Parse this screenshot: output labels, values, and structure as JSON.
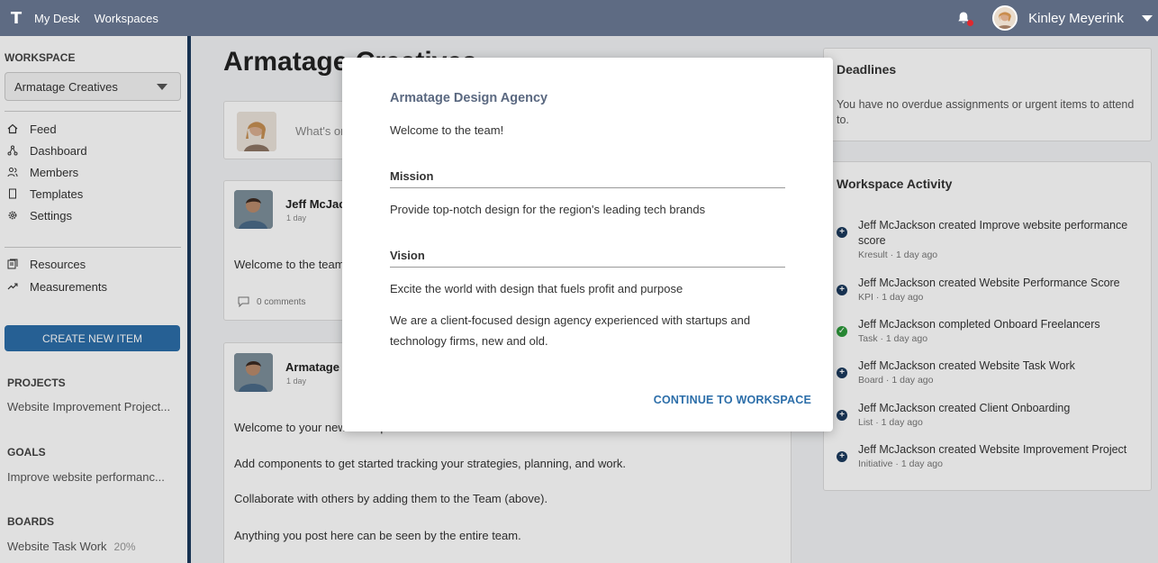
{
  "topbar": {
    "logo": "T",
    "nav": [
      "My Desk",
      "Workspaces"
    ],
    "user_name": "Kinley Meyerink"
  },
  "sidebar": {
    "workspace_heading": "WORKSPACE",
    "workspace_selected": "Armatage Creatives",
    "nav_items": [
      {
        "label": "Feed",
        "icon": "home-icon"
      },
      {
        "label": "Dashboard",
        "icon": "dashboard-icon"
      },
      {
        "label": "Members",
        "icon": "members-icon"
      },
      {
        "label": "Templates",
        "icon": "templates-icon"
      },
      {
        "label": "Settings",
        "icon": "gear-icon"
      }
    ],
    "secondary_items": [
      {
        "label": "Resources",
        "icon": "resources-icon"
      },
      {
        "label": "Measurements",
        "icon": "trend-icon"
      }
    ],
    "create_button": "CREATE NEW ITEM",
    "projects_heading": "PROJECTS",
    "project": "Website Improvement Project...",
    "goals_heading": "GOALS",
    "goal": "Improve website performanc...",
    "boards_heading": "BOARDS",
    "board": "Website Task Work",
    "board_pct": "20%"
  },
  "main": {
    "title": "Armatage Creatives",
    "compose_placeholder": "What's on your mind?",
    "posts": [
      {
        "author": "Jeff McJackson",
        "time": "1 day",
        "text": "Welcome to the team!",
        "comments": "0 comments"
      },
      {
        "author": "Armatage Creatives",
        "time": "1 day",
        "lines": [
          "Welcome to your new workspace!",
          "Add components to get started tracking your strategies, planning, and work.",
          "Collaborate with others by adding them to the Team (above).",
          "Anything you post here can be seen by the entire team."
        ]
      }
    ]
  },
  "deadlines": {
    "title": "Deadlines",
    "text": "You have no overdue assignments or urgent items to attend to."
  },
  "activity": {
    "title": "Workspace Activity",
    "items": [
      {
        "text": "Jeff McJackson created Improve website performance score",
        "meta": "Kresult · 1 day ago",
        "status": "created"
      },
      {
        "text": "Jeff McJackson created Website Performance Score",
        "meta": "KPI · 1 day ago",
        "status": "created"
      },
      {
        "text": "Jeff McJackson completed Onboard Freelancers",
        "meta": "Task · 1 day ago",
        "status": "completed"
      },
      {
        "text": "Jeff McJackson created Website Task Work",
        "meta": "Board · 1 day ago",
        "status": "created"
      },
      {
        "text": "Jeff McJackson created Client Onboarding",
        "meta": "List · 1 day ago",
        "status": "created"
      },
      {
        "text": "Jeff McJackson created Website Improvement Project",
        "meta": "Initiative · 1 day ago",
        "status": "created"
      }
    ]
  },
  "modal": {
    "title": "Armatage Design Agency",
    "welcome": "Welcome to the team!",
    "mission_heading": "Mission",
    "mission_text": "Provide top-notch design for the region's leading tech brands",
    "vision_heading": "Vision",
    "vision_text": "Excite the world with design that fuels profit and purpose",
    "about_text": "We are a client-focused design agency experienced with startups and technology firms, new and old.",
    "continue_button": "CONTINUE TO WORKSPACE"
  },
  "colors": {
    "topbar": "#5e6b83",
    "primary_button": "#2c6ea9",
    "sidebar_edge": "#1b3a5d",
    "notification_dot": "#e0282e",
    "completed": "#2e9b3c"
  }
}
